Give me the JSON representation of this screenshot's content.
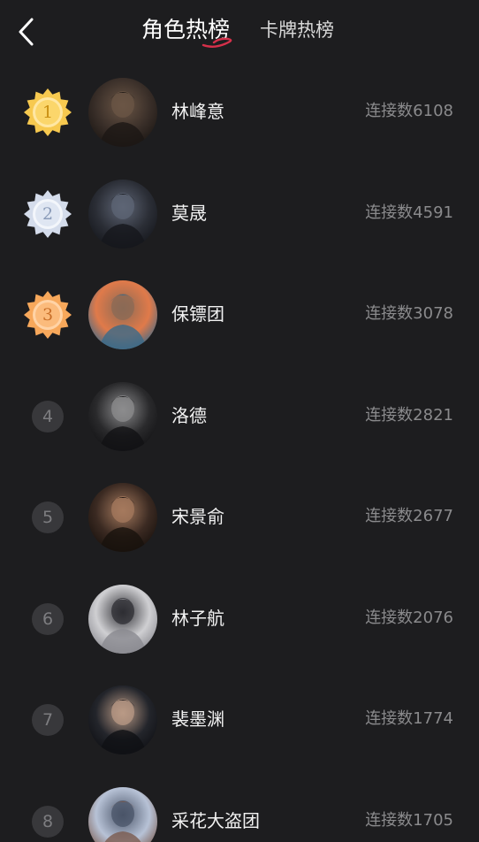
{
  "header": {
    "tabs": [
      {
        "label": "角色热榜",
        "active": true
      },
      {
        "label": "卡牌热榜",
        "active": false
      }
    ]
  },
  "colors": {
    "background": "#1d1d1f",
    "gold": "#f2c14e",
    "silver": "#c9d3e2",
    "bronze": "#f5a45a",
    "accent_underline": "#d6304a"
  },
  "list": [
    {
      "rank": "1",
      "medal": "gold",
      "name": "林峰意",
      "count": "连接数6108",
      "avatar_palette": [
        "#3a2f29",
        "#6b5646",
        "#1c1714"
      ]
    },
    {
      "rank": "2",
      "medal": "silver",
      "name": "莫晟",
      "count": "连接数4591",
      "avatar_palette": [
        "#2b2e36",
        "#5e6575",
        "#15171c"
      ]
    },
    {
      "rank": "3",
      "medal": "bronze",
      "name": "保镖团",
      "count": "连接数3078",
      "avatar_palette": [
        "#e07a4a",
        "#8a6a55",
        "#3a6a8a"
      ]
    },
    {
      "rank": "4",
      "medal": "",
      "name": "洛德",
      "count": "连接数2821",
      "avatar_palette": [
        "#2a2a2c",
        "#8c8c8e",
        "#121214"
      ]
    },
    {
      "rank": "5",
      "medal": "",
      "name": "宋景俞",
      "count": "连接数2677",
      "avatar_palette": [
        "#3b2a22",
        "#a57a5e",
        "#18110d"
      ]
    },
    {
      "rank": "6",
      "medal": "",
      "name": "林子航",
      "count": "连接数2076",
      "avatar_palette": [
        "#cfcfd2",
        "#2e2e33",
        "#8a8a90"
      ]
    },
    {
      "rank": "7",
      "medal": "",
      "name": "裴墨渊",
      "count": "连接数1774",
      "avatar_palette": [
        "#23252b",
        "#b99a86",
        "#0f1014"
      ]
    },
    {
      "rank": "8",
      "medal": "",
      "name": "采花大盗团",
      "count": "连接数1705",
      "avatar_palette": [
        "#b7c2d6",
        "#4a5468",
        "#7a5a4e"
      ]
    }
  ]
}
